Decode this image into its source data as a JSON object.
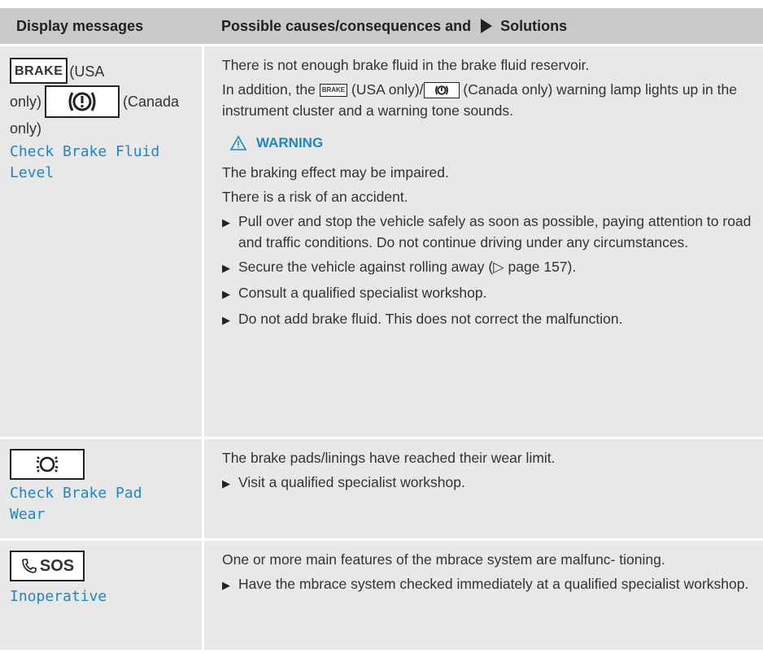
{
  "header": {
    "col1": "Display messages",
    "col2_text": "Possible causes/consequences and",
    "col2_solutions": "Solutions"
  },
  "row1": {
    "brake_label": "BRAKE",
    "usa_text": "(USA",
    "only_text": "only)",
    "canada_text": "(Canada",
    "canada_only": "only)",
    "message": "Check Brake Fluid Level",
    "para1": "There is not enough brake fluid in the brake fluid reservoir.",
    "para2_a": "In addition, the",
    "para2_b": "(USA only)/",
    "para2_c": "(Canada only) warning lamp lights up in the instrument cluster and a warning tone sounds.",
    "warning_title": "WARNING",
    "warn1": "The braking effect may be impaired.",
    "warn2": "There is a risk of an accident.",
    "bullets": [
      "Pull over and stop the vehicle safely as soon as possible, paying attention to road and traffic conditions. Do not continue driving under any circumstances.",
      "Secure the vehicle against rolling away (▷ page 157).",
      "Consult a qualified specialist workshop.",
      "Do not add brake fluid. This does not correct the malfunction."
    ]
  },
  "row2": {
    "message": "Check Brake Pad Wear",
    "para1": "The brake pads/linings have reached their wear limit.",
    "bullets": [
      "Visit a qualified specialist workshop."
    ]
  },
  "row3": {
    "sos_label": "SOS",
    "message": "Inoperative",
    "para1": "One or more main features of the mbrace system are malfunc- tioning.",
    "bullets": [
      "Have the mbrace system checked immediately at a qualified specialist workshop."
    ]
  },
  "colors": {
    "accent": "#1f86c6",
    "header_bg": "#c9c9c9",
    "row_bg": "#e8e8e8"
  }
}
